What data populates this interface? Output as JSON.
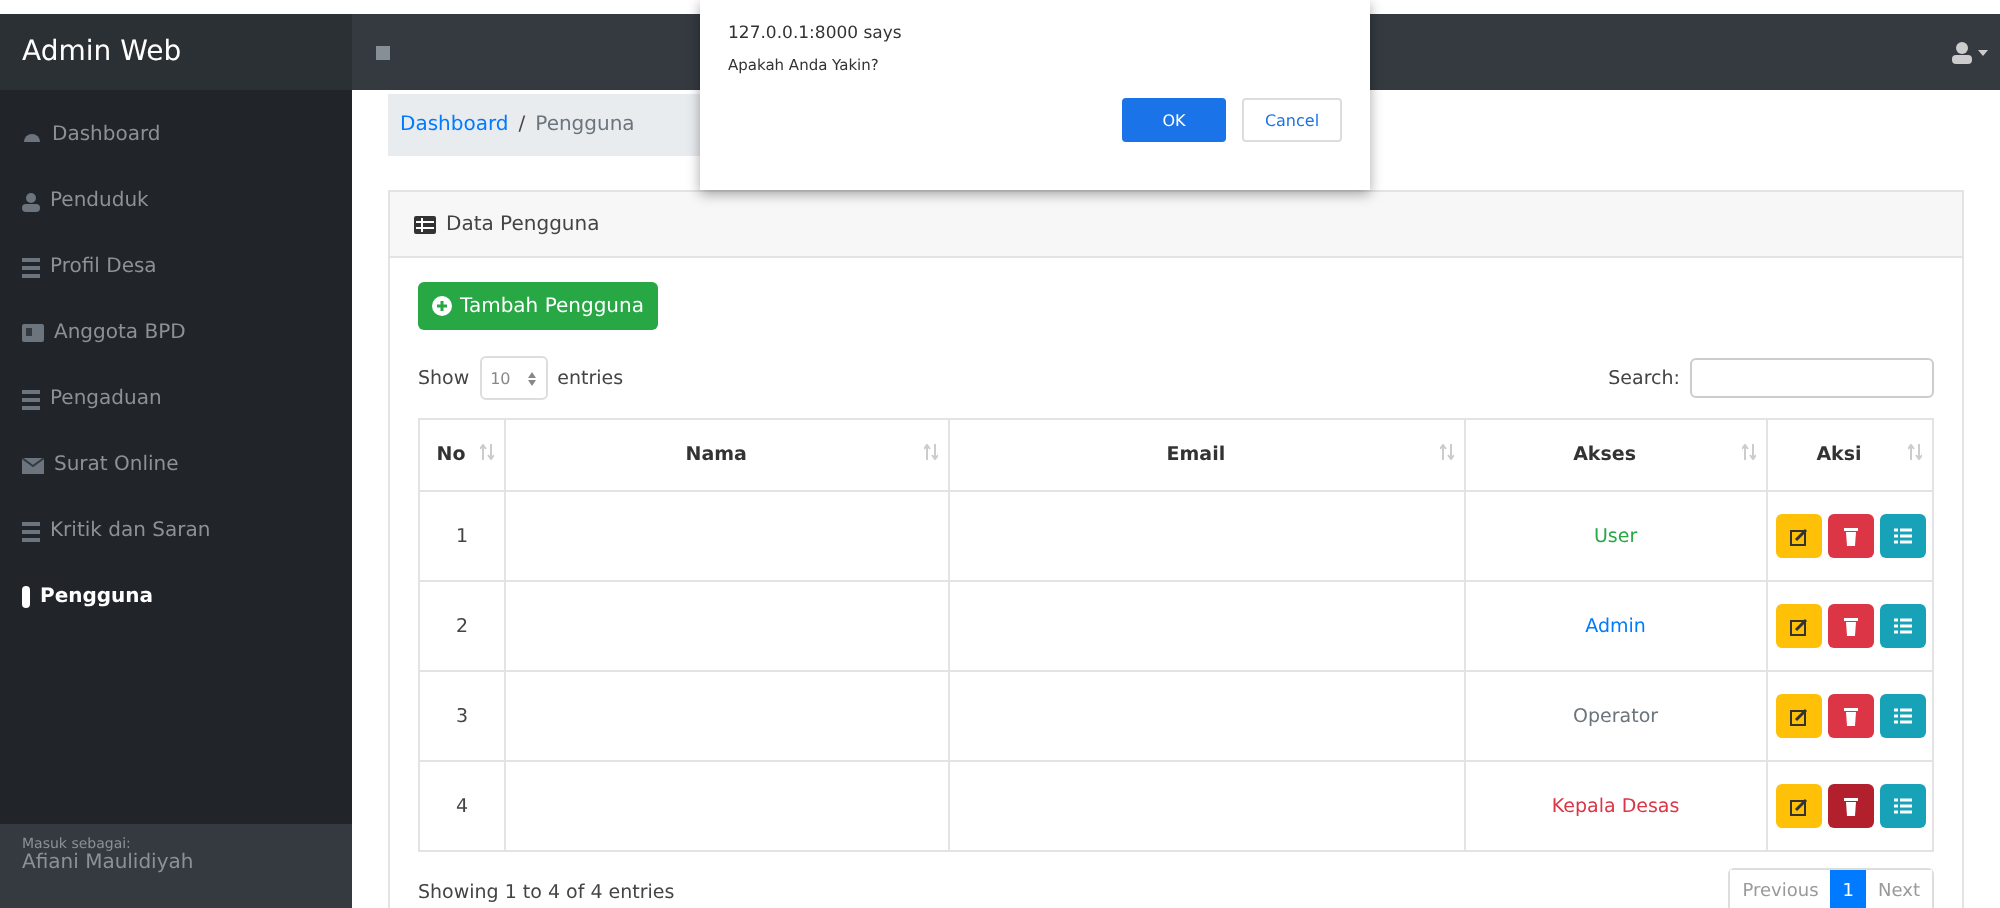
{
  "topbar": {
    "brand": "Admin Web"
  },
  "sidebar": {
    "items": [
      {
        "label": "Dashboard",
        "selected": false
      },
      {
        "label": "Penduduk",
        "selected": false
      },
      {
        "label": "Profil Desa",
        "selected": false
      },
      {
        "label": "Anggota BPD",
        "selected": false
      },
      {
        "label": "Pengaduan",
        "selected": false
      },
      {
        "label": "Surat Online",
        "selected": false
      },
      {
        "label": "Kritik dan Saran",
        "selected": false
      },
      {
        "label": "Pengguna",
        "selected": true
      }
    ],
    "footer_label": "Masuk sebagai:",
    "footer_user": "Afiani Maulidiyah"
  },
  "breadcrumb": {
    "link": "Dashboard",
    "separator": "/",
    "current": "Pengguna"
  },
  "card": {
    "title": "Data Pengguna",
    "add_button": "Tambah Pengguna",
    "show_label": "Show",
    "page_size": "10",
    "entries_label": "entries",
    "search_label": "Search:",
    "columns": [
      "No",
      "Nama",
      "Email",
      "Akses",
      "Aksi"
    ],
    "rows": [
      {
        "no": "1",
        "akses": "User",
        "color": "#28a745",
        "delete_active": false
      },
      {
        "no": "2",
        "akses": "Admin",
        "color": "#007bff",
        "delete_active": false
      },
      {
        "no": "3",
        "akses": "Operator",
        "color": "#6c757d",
        "delete_active": false
      },
      {
        "no": "4",
        "akses": "Kepala Desas",
        "color": "#dc3545",
        "delete_active": true
      }
    ],
    "info": "Showing 1 to 4 of 4 entries",
    "pagination": [
      {
        "label": "Previous",
        "selected": false
      },
      {
        "label": "1",
        "selected": true
      },
      {
        "label": "Next",
        "selected": false
      }
    ]
  },
  "dialog": {
    "origin": "127.0.0.1:8000 says",
    "message": "Apakah Anda Yakin?",
    "ok": "OK",
    "cancel": "Cancel"
  }
}
